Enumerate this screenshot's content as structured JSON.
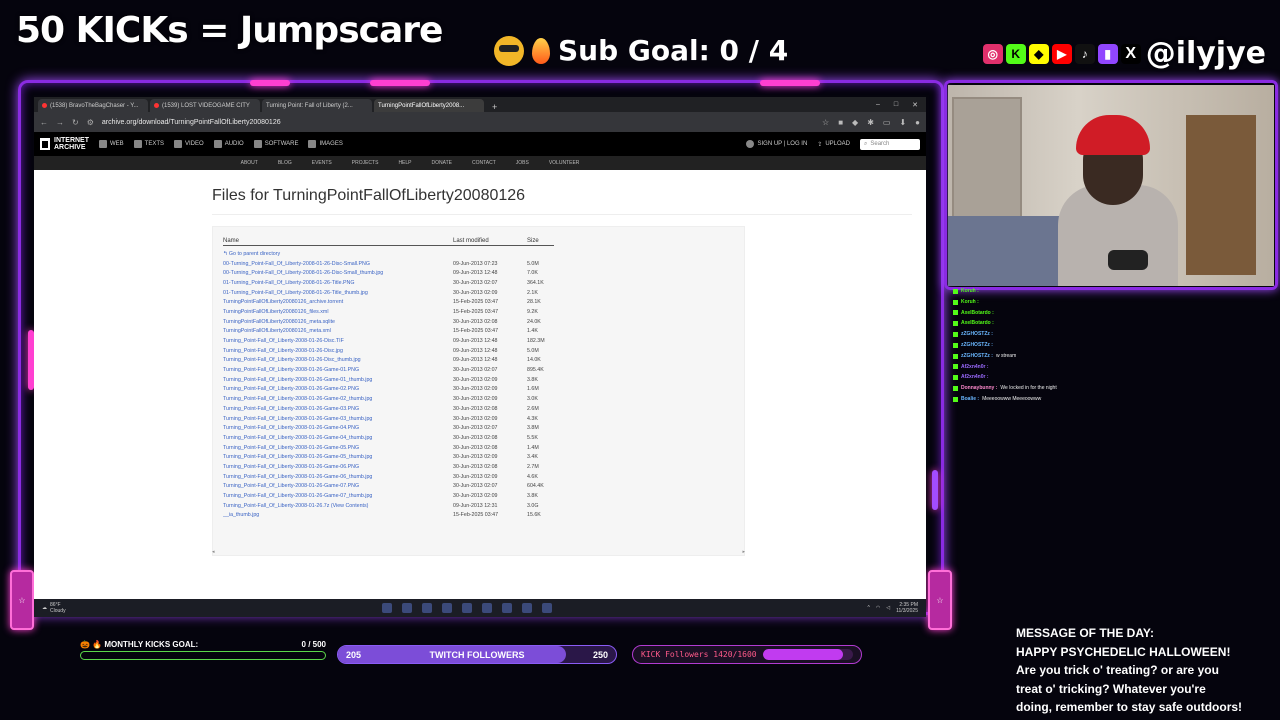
{
  "overlay": {
    "kicks_title": "50 KICKs = Jumpscare",
    "sub_goal": "Sub Goal:  0 / 4",
    "handle": "@ilyjye",
    "neon_color": "#8a2be2",
    "accent_pink": "#ff3fd1"
  },
  "browser": {
    "tabs": [
      {
        "label": "(1538) BravoTheBagChaser - Y..."
      },
      {
        "label": "(1539) LOST VIDEOGAME CITY"
      },
      {
        "label": "Turning Point: Fall of Liberty (2..."
      },
      {
        "label": "TurningPointFallOfLiberty2008..."
      }
    ],
    "url": "archive.org/download/TurningPointFallOfLiberty20080126",
    "ia": {
      "logo_line1": "INTERNET",
      "logo_line2": "ARCHIVE",
      "nav": [
        "WEB",
        "TEXTS",
        "VIDEO",
        "AUDIO",
        "SOFTWARE",
        "IMAGES"
      ],
      "signup": "SIGN UP | LOG IN",
      "upload": "UPLOAD",
      "search_placeholder": "Search",
      "subnav": [
        "ABOUT",
        "BLOG",
        "EVENTS",
        "PROJECTS",
        "HELP",
        "DONATE",
        "CONTACT",
        "JOBS",
        "VOLUNTEER"
      ]
    },
    "page_title": "Files for TurningPointFallOfLiberty20080126",
    "columns": {
      "name": "Name",
      "modified": "Last modified",
      "size": "Size"
    },
    "parent_link": "Go to parent directory",
    "files": [
      {
        "name": "00-Turning_Point-Fall_Of_Liberty-2008-01-26-Disc-Small.PNG",
        "date": "09-Jun-2013 07:23",
        "size": "5.0M"
      },
      {
        "name": "00-Turning_Point-Fall_Of_Liberty-2008-01-26-Disc-Small_thumb.jpg",
        "date": "09-Jun-2013 12:48",
        "size": "7.0K"
      },
      {
        "name": "01-Turning_Point-Fall_Of_Liberty-2008-01-26-Title.PNG",
        "date": "30-Jun-2013 02:07",
        "size": "364.1K"
      },
      {
        "name": "01-Turning_Point-Fall_Of_Liberty-2008-01-26-Title_thumb.jpg",
        "date": "30-Jun-2013 02:09",
        "size": "2.1K"
      },
      {
        "name": "TurningPointFallOfLiberty20080126_archive.torrent",
        "date": "15-Feb-2025 03:47",
        "size": "28.1K"
      },
      {
        "name": "TurningPointFallOfLiberty20080126_files.xml",
        "date": "15-Feb-2025 03:47",
        "size": "9.2K"
      },
      {
        "name": "TurningPointFallOfLiberty20080126_meta.sqlite",
        "date": "30-Jun-2013 02:08",
        "size": "24.0K"
      },
      {
        "name": "TurningPointFallOfLiberty20080126_meta.xml",
        "date": "15-Feb-2025 03:47",
        "size": "1.4K"
      },
      {
        "name": "Turning_Point-Fall_Of_Liberty-2008-01-26-Disc.TIF",
        "date": "09-Jun-2013 12:48",
        "size": "182.3M"
      },
      {
        "name": "Turning_Point-Fall_Of_Liberty-2008-01-26-Disc.jpg",
        "date": "09-Jun-2013 12:48",
        "size": "5.0M"
      },
      {
        "name": "Turning_Point-Fall_Of_Liberty-2008-01-26-Disc_thumb.jpg",
        "date": "09-Jun-2013 12:48",
        "size": "14.0K"
      },
      {
        "name": "Turning_Point-Fall_Of_Liberty-2008-01-26-Game-01.PNG",
        "date": "30-Jun-2013 02:07",
        "size": "895.4K"
      },
      {
        "name": "Turning_Point-Fall_Of_Liberty-2008-01-26-Game-01_thumb.jpg",
        "date": "30-Jun-2013 02:09",
        "size": "3.8K"
      },
      {
        "name": "Turning_Point-Fall_Of_Liberty-2008-01-26-Game-02.PNG",
        "date": "30-Jun-2013 02:09",
        "size": "1.6M"
      },
      {
        "name": "Turning_Point-Fall_Of_Liberty-2008-01-26-Game-02_thumb.jpg",
        "date": "30-Jun-2013 02:09",
        "size": "3.0K"
      },
      {
        "name": "Turning_Point-Fall_Of_Liberty-2008-01-26-Game-03.PNG",
        "date": "30-Jun-2013 02:08",
        "size": "2.6M"
      },
      {
        "name": "Turning_Point-Fall_Of_Liberty-2008-01-26-Game-03_thumb.jpg",
        "date": "30-Jun-2013 02:09",
        "size": "4.3K"
      },
      {
        "name": "Turning_Point-Fall_Of_Liberty-2008-01-26-Game-04.PNG",
        "date": "30-Jun-2013 02:07",
        "size": "3.8M"
      },
      {
        "name": "Turning_Point-Fall_Of_Liberty-2008-01-26-Game-04_thumb.jpg",
        "date": "30-Jun-2013 02:08",
        "size": "5.5K"
      },
      {
        "name": "Turning_Point-Fall_Of_Liberty-2008-01-26-Game-05.PNG",
        "date": "30-Jun-2013 02:08",
        "size": "1.4M"
      },
      {
        "name": "Turning_Point-Fall_Of_Liberty-2008-01-26-Game-05_thumb.jpg",
        "date": "30-Jun-2013 02:09",
        "size": "3.4K"
      },
      {
        "name": "Turning_Point-Fall_Of_Liberty-2008-01-26-Game-06.PNG",
        "date": "30-Jun-2013 02:08",
        "size": "2.7M"
      },
      {
        "name": "Turning_Point-Fall_Of_Liberty-2008-01-26-Game-06_thumb.jpg",
        "date": "30-Jun-2013 02:09",
        "size": "4.6K"
      },
      {
        "name": "Turning_Point-Fall_Of_Liberty-2008-01-26-Game-07.PNG",
        "date": "30-Jun-2013 02:07",
        "size": "604.4K"
      },
      {
        "name": "Turning_Point-Fall_Of_Liberty-2008-01-26-Game-07_thumb.jpg",
        "date": "30-Jun-2013 02:09",
        "size": "3.8K"
      },
      {
        "name": "Turning_Point-Fall_Of_Liberty-2008-01-26.7z (View Contents)",
        "date": "09-Jun-2013 12:31",
        "size": "3.0G"
      },
      {
        "name": "__ia_thumb.jpg",
        "date": "15-Feb-2025 03:47",
        "size": "15.6K"
      }
    ],
    "taskbar": {
      "temp": "86°F",
      "weather": "Cloudy",
      "time": "2:35 PM",
      "date": "11/3/2025"
    }
  },
  "chat": [
    {
      "user": "Koruh :",
      "msg": "",
      "cls": ""
    },
    {
      "user": "Koruh :",
      "msg": "",
      "cls": ""
    },
    {
      "user": "AxelBotardo :",
      "msg": "",
      "cls": ""
    },
    {
      "user": "AxelBotardo :",
      "msg": "",
      "cls": ""
    },
    {
      "user": "zZGHOSTZz :",
      "msg": "",
      "cls": "u4"
    },
    {
      "user": "zZGHOSTZz :",
      "msg": "",
      "cls": "u4"
    },
    {
      "user": "zZGHOSTZz :",
      "msg": "w stream",
      "cls": "u4"
    },
    {
      "user": "Af2xn4n0r :",
      "msg": "",
      "cls": "u2"
    },
    {
      "user": "Af2xn4n0r :",
      "msg": "",
      "cls": "u2"
    },
    {
      "user": "Donnaybunny :",
      "msg": "We locked in for the night",
      "cls": "u3"
    },
    {
      "user": "Boalie :",
      "msg": "Meeeoowww Meeeoowww",
      "cls": "u4"
    }
  ],
  "goals": {
    "monthly_kicks_label": "MONTHLY KICKS GOAL:",
    "monthly_kicks_value": "0 / 500",
    "monthly_kicks_progress": 0,
    "twitch_current": "205",
    "twitch_label": "TWITCH FOLLOWERS",
    "twitch_target": "250",
    "twitch_progress": 0.82,
    "kick_followers_label": "KICK Followers 1420/1600",
    "kick_followers_progress": 0.8875
  },
  "motd": {
    "heading": "MESSAGE OF THE DAY:",
    "line1": "HAPPY PSYCHEDELIC HALLOWEEN!",
    "line2": "Are you trick o' treating? or are you",
    "line3": "treat o' tricking? Whatever you're",
    "line4": "doing, remember to stay safe outdoors!"
  }
}
